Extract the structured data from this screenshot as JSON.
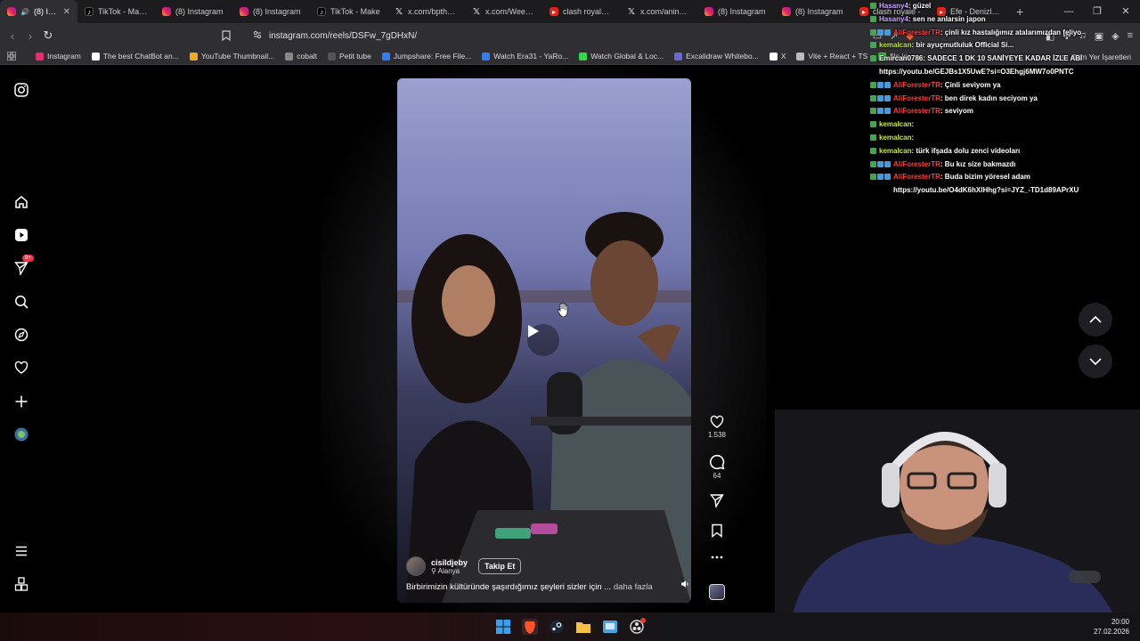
{
  "browser": {
    "tabs": [
      {
        "label": "(8) Insta",
        "icon": "instagram-icon",
        "active": true
      },
      {
        "label": "TikTok - Make Y",
        "icon": "tiktok-icon"
      },
      {
        "label": "(8) Instagram",
        "icon": "instagram-icon"
      },
      {
        "label": "(8) Instagram",
        "icon": "instagram-icon"
      },
      {
        "label": "TikTok - Make",
        "icon": "tiktok-icon"
      },
      {
        "label": "x.com/bpthabe",
        "icon": "x-icon"
      },
      {
        "label": "x.com/WeedPo",
        "icon": "x-icon"
      },
      {
        "label": "clash royale - Y",
        "icon": "youtube-icon"
      },
      {
        "label": "x.com/anindan",
        "icon": "x-icon"
      },
      {
        "label": "(8) Instagram",
        "icon": "instagram-icon"
      },
      {
        "label": "(8) Instagram",
        "icon": "instagram-icon"
      },
      {
        "label": "clash royale -",
        "icon": "youtube-icon"
      },
      {
        "label": "Efe - Denizlinin",
        "icon": "youtube-icon"
      }
    ],
    "url": "instagram.com/reels/DSFw_7gDHxN/",
    "bookmarks": [
      {
        "label": "Instagram",
        "color": "#e1306c"
      },
      {
        "label": "The best ChatBot an...",
        "color": "#ffffff"
      },
      {
        "label": "YouTube Thumbnail...",
        "color": "#f5a623"
      },
      {
        "label": "cobalt",
        "color": "#888888"
      },
      {
        "label": "Petit tube",
        "color": "#555555"
      },
      {
        "label": "Jumpshare: Free File...",
        "color": "#2d7ff9"
      },
      {
        "label": "Watch Era31 - YaRo...",
        "color": "#2d7ff9"
      },
      {
        "label": "Watch Global & Loc...",
        "color": "#32d74b"
      },
      {
        "label": "Excalidraw Whitebo...",
        "color": "#6965db"
      },
      {
        "label": "X",
        "color": "#ffffff"
      },
      {
        "label": "Vite + React + TS",
        "color": "#bbbbbb"
      },
      {
        "label": "file.io",
        "color": "#3ec23e"
      }
    ],
    "all_bookmarks_label": "Tüm Yer İşaretleri"
  },
  "reel": {
    "username": "cisildjeby",
    "location": "Alanya",
    "follow_label": "Takip Et",
    "caption": "Birbirimizin kültüründe şaşırdığımız şeyleri sizler için ...",
    "more_label": "daha fazla",
    "likes": "1.538",
    "comments": "64"
  },
  "chat": [
    {
      "user": "Hasany4",
      "color": "#c8a8ff",
      "message": ": güzel",
      "badges": [
        "#3ea84a"
      ]
    },
    {
      "user": "Hasany4",
      "color": "#c8a8ff",
      "message": ": sen ne anlarsin japon",
      "badges": [
        "#3ea84a"
      ]
    },
    {
      "user": "AliForesterTR",
      "color": "#ff3b3b",
      "message": ": çinli kız hastalığımız atalarımızdan feliyo",
      "badges": [
        "#3ea84a",
        "#3d9ee6",
        "#3d9ee6"
      ]
    },
    {
      "user": "kemalcan",
      "color": "#c6e83a",
      "message": ": bir ayuçmutluluk Official Si...",
      "badges": [
        "#3ea84a"
      ]
    },
    {
      "user": "Emircan0786",
      "color": "#ffffff",
      "message": ": SADECE 1 DK 10 SANİYEYE KADAR İZLE ABİ https://youtu.be/GEJBs1X5UwE?si=O3Ehgj6MW7o0PNTC",
      "badges": [
        "#3ea84a"
      ]
    },
    {
      "user": "AliForesterTR",
      "color": "#ff3b3b",
      "message": ": Çinli seviyom ya",
      "badges": [
        "#3ea84a",
        "#3d9ee6",
        "#3d9ee6"
      ]
    },
    {
      "user": "AliForesterTR",
      "color": "#ff3b3b",
      "message": ": ben direk kadın seciyom ya",
      "badges": [
        "#3ea84a",
        "#3d9ee6",
        "#3d9ee6"
      ]
    },
    {
      "user": "AliForesterTR",
      "color": "#ff3b3b",
      "message": ": seviyom",
      "badges": [
        "#3ea84a",
        "#3d9ee6",
        "#3d9ee6"
      ]
    },
    {
      "user": "kemalcan",
      "color": "#c6e83a",
      "message": ":",
      "badges": [
        "#3ea84a"
      ]
    },
    {
      "user": "kemalcan",
      "color": "#c6e83a",
      "message": ":",
      "badges": [
        "#3ea84a"
      ]
    },
    {
      "user": "kemalcan",
      "color": "#c6e83a",
      "message": ": türk ifşada dolu zenci videoları",
      "badges": [
        "#3ea84a"
      ]
    },
    {
      "user": "AliForesterTR",
      "color": "#ff3b3b",
      "message": ": Bu kız size bakmazdı",
      "badges": [
        "#3ea84a",
        "#3d9ee6",
        "#3d9ee6"
      ]
    },
    {
      "user": "AliForesterTR",
      "color": "#ff3b3b",
      "message": ": Buda bizim yöresel adam https://youtu.be/O4dK6hXlHhg?si=JYZ_-TD1d89APrXU",
      "badges": [
        "#3ea84a",
        "#3d9ee6",
        "#3d9ee6"
      ]
    }
  ],
  "clock": {
    "time": "20:00",
    "date": "27.02.2026"
  }
}
